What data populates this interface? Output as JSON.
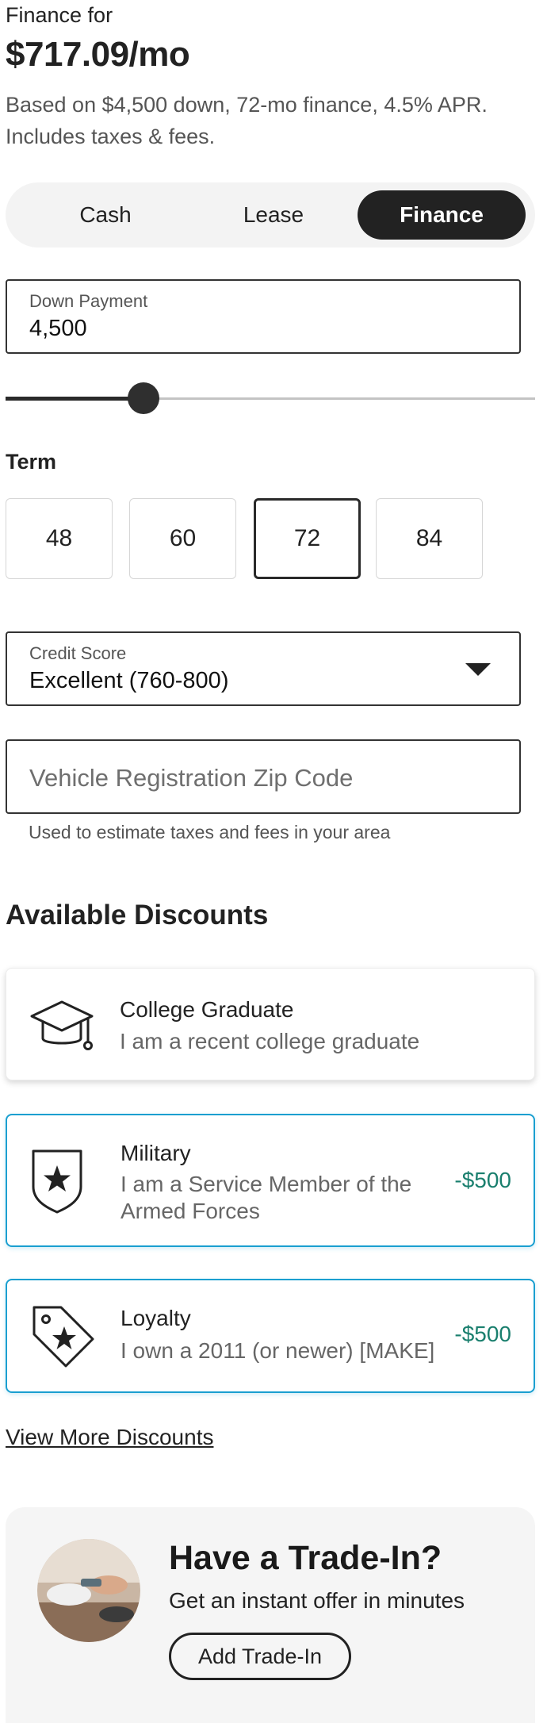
{
  "header": {
    "eyebrow": "Finance for",
    "price": "$717.09/mo",
    "subtext": "Based on $4,500 down, 72-mo finance, 4.5% APR. Includes taxes & fees."
  },
  "payment_type": {
    "options": [
      "Cash",
      "Lease",
      "Finance"
    ],
    "selected": "Finance"
  },
  "down_payment": {
    "label": "Down Payment",
    "value": "4,500",
    "slider_fraction": 0.26
  },
  "term": {
    "label": "Term",
    "options": [
      "48",
      "60",
      "72",
      "84"
    ],
    "selected": "72"
  },
  "credit_score": {
    "label": "Credit Score",
    "value": "Excellent (760-800)"
  },
  "zip": {
    "placeholder": "Vehicle Registration Zip Code",
    "helper": "Used to estimate taxes and fees in your area"
  },
  "discounts": {
    "title": "Available Discounts",
    "items": [
      {
        "title": "College Graduate",
        "description": "I am a recent college graduate",
        "amount": "",
        "icon": "graduation-cap-icon",
        "selected": false
      },
      {
        "title": "Military",
        "description": "I am a Service Member of the Armed Forces",
        "amount": "-$500",
        "icon": "shield-star-icon",
        "selected": true
      },
      {
        "title": "Loyalty",
        "description": "I own a 2011 (or newer) [MAKE]",
        "amount": "-$500",
        "icon": "tag-star-icon",
        "selected": true
      }
    ],
    "view_more": "View More Discounts"
  },
  "trade_in": {
    "title": "Have a Trade-In?",
    "subtitle": "Get an instant offer in minutes",
    "button": "Add Trade-In"
  },
  "colors": {
    "dark": "#222222",
    "accent_border": "#1a9fd0",
    "discount_green": "#1a7f6e"
  }
}
